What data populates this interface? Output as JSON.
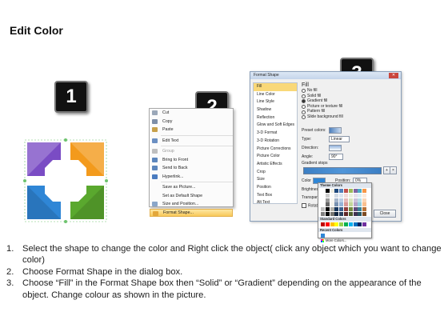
{
  "title": "Edit Color",
  "badges": [
    "1",
    "2",
    "3"
  ],
  "shape_colors": {
    "purple": "#7a4cc4",
    "orange": "#f39a1c",
    "blue": "#2f86d6",
    "green": "#5aa82e"
  },
  "context_menu": {
    "items": [
      {
        "label": "Cut",
        "icon_color": "#9aa7b8",
        "enabled": true
      },
      {
        "label": "Copy",
        "icon_color": "#7d8ea8",
        "enabled": true
      },
      {
        "label": "Paste",
        "icon_color": "#c7a04b",
        "enabled": true
      },
      {
        "label": "Edit Text",
        "icon_color": "#6b8fc2",
        "enabled": true
      },
      {
        "label": "Group",
        "icon_color": "#bfbfbf",
        "enabled": false
      },
      {
        "label": "Bring to Front",
        "icon_color": "#5c86bd",
        "enabled": true
      },
      {
        "label": "Send to Back",
        "icon_color": "#5c86bd",
        "enabled": true
      },
      {
        "label": "Hyperlink...",
        "icon_color": "#4a7cc0",
        "enabled": true
      },
      {
        "label": "Save as Picture...",
        "icon_color": "",
        "enabled": true
      },
      {
        "label": "Set as Default Shape",
        "icon_color": "",
        "enabled": true
      },
      {
        "label": "Size and Position...",
        "icon_color": "#8aa6c9",
        "enabled": true
      },
      {
        "label": "Format Shape...",
        "icon_color": "#e3a73a",
        "enabled": true
      }
    ]
  },
  "format_dialog": {
    "title": "Format Shape",
    "nav": [
      "Fill",
      "Line Color",
      "Line Style",
      "Shadow",
      "Reflection",
      "Glow and Soft Edges",
      "3-D Format",
      "3-D Rotation",
      "Picture Corrections",
      "Picture Color",
      "Artistic Effects",
      "Crop",
      "Size",
      "Position",
      "Text Box",
      "Alt Text"
    ],
    "heading": "Fill",
    "options": [
      "No fill",
      "Solid fill",
      "Gradient fill",
      "Picture or texture fill",
      "Pattern fill",
      "Slide background fill"
    ],
    "selected_option": "Gradient fill",
    "preset_label": "Preset colors:",
    "type_label": "Type:",
    "type_value": "Linear",
    "direction_label": "Direction:",
    "angle_label": "Angle:",
    "angle_value": "90°",
    "stops_label": "Gradient stops",
    "color_label": "Color",
    "position_label": "Position:",
    "position_value": "0%",
    "brightness_label": "Brightness:",
    "transparency_label": "Transparency:",
    "rotate_label": "Rotate w",
    "close_label": "Close"
  },
  "color_picker": {
    "theme_label": "Theme Colors",
    "standard_label": "Standard Colors",
    "recent_label": "Recent Colors",
    "more_label": "More Colors...",
    "theme_top": [
      "#ffffff",
      "#000000",
      "#eeece1",
      "#1f497d",
      "#4f81bd",
      "#c0504d",
      "#9bbb59",
      "#8064a2",
      "#4bacc6",
      "#f79646"
    ],
    "standard": [
      "#c00000",
      "#ff0000",
      "#ffc000",
      "#ffff00",
      "#92d050",
      "#00b050",
      "#00b0f0",
      "#0070c0",
      "#002060",
      "#7030a0"
    ],
    "recent": [
      "#2f86d6"
    ]
  },
  "steps": [
    {
      "num": "1.",
      "text": "Select the shape to change the color and Right click the object( click any object which you want to change color)"
    },
    {
      "num": "2.",
      "text": "Choose Format Shape in the dialog box."
    },
    {
      "num": "3.",
      "text": "Choose “Fill” in the Format Shape box then “Solid” or “Gradient” depending on the appearance of the object. Change colour as shown in the picture."
    }
  ]
}
